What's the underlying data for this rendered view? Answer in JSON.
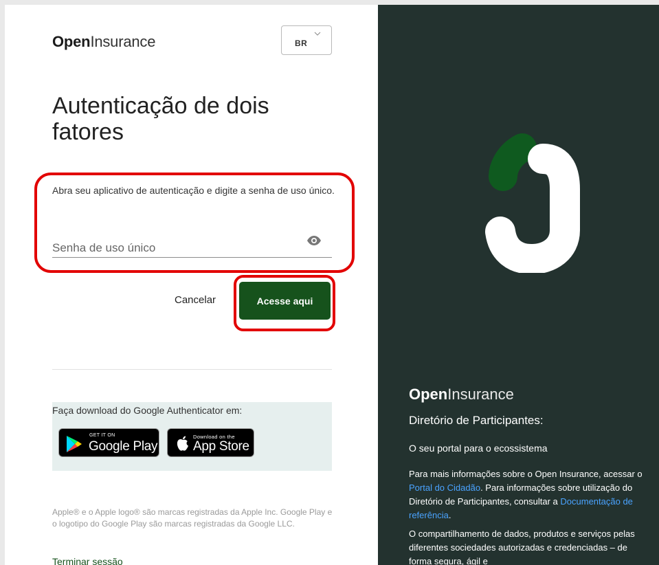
{
  "brand": {
    "bold": "Open",
    "thin": "Insurance"
  },
  "language": {
    "selected": "BR"
  },
  "title": "Autenticação de dois fatores",
  "instruction": "Abra seu aplicativo de autenticação e digite a senha de uso único.",
  "otp": {
    "placeholder": "Senha de uso único",
    "value": ""
  },
  "actions": {
    "cancel_label": "Cancelar",
    "submit_label": "Acesse aqui"
  },
  "download": {
    "text": "Faça download do Google Authenticator em:",
    "google_play": {
      "small": "GET IT ON",
      "big": "Google Play"
    },
    "app_store": {
      "small": "Download on the",
      "big": "App Store"
    }
  },
  "legal": "Apple® e o Apple logo® são marcas registradas da Apple Inc. Google Play e o logotipo do Google Play são marcas registradas da Google LLC.",
  "logout_label": "Terminar sessão",
  "side": {
    "brand": {
      "bold": "Open",
      "thin": "Insurance"
    },
    "heading": "Diretório de Participantes:",
    "subheading": "O seu portal para o ecossistema",
    "para_pre": "Para mais informações sobre o Open Insurance, acessar o ",
    "link1": "Portal do Cidadão",
    "para_mid": ". Para informações sobre utilização do Diretório de Participantes, consultar a ",
    "link2": "Documentação de referência",
    "para_end": ".",
    "para2": "O compartilhamento de dados, produtos e serviços pelas diferentes sociedades autorizadas e credenciadas – de forma segura, ágil e"
  },
  "colors": {
    "accent_green": "#16521c",
    "side_bg": "#23322f",
    "highlight_red": "#e20000",
    "link_blue": "#4aa3ff"
  }
}
